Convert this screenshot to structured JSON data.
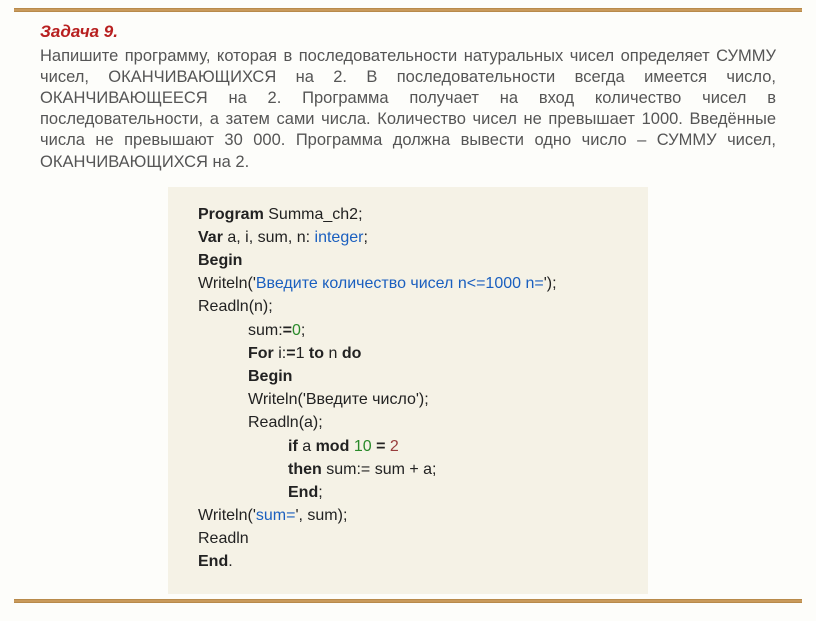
{
  "title": "Задача 9.",
  "description": "Напишите программу, которая в последовательности натуральных чисел определяет СУММУ чисел, ОКАНЧИВАЮЩИХСЯ на 2. В последовательности всегда имеется число, ОКАНЧИВАЮЩЕЕСЯ на 2. Программа получает на вход количество чисел в последовательности, а затем сами числа. Количество чисел не превышает 1000. Введённые числа не превышают 30 000. Программа должна вывести одно число – СУММУ чисел, ОКАНЧИВАЮЩИХСЯ на 2.",
  "code": {
    "l1_kw": "Program",
    "l1_rest": " Summa_ch2;",
    "l2_kw": "Var",
    "l2_rest_a": " a, i, sum, n: ",
    "l2_type": "integer",
    "l2_rest_b": ";",
    "l3": "Begin",
    "l4_a": "Writeln('",
    "l4_str": "Введите количество чисел n<=1000 n=",
    "l4_b": "');",
    "l5": "Readln(n);",
    "l6_a": "sum:",
    "l6_eq": "=",
    "l6_zero": "0",
    "l6_b": ";",
    "l7_for": "For",
    "l7_a": " i:",
    "l7_eq": "=",
    "l7_b": "1 ",
    "l7_to": "to",
    "l7_c": " n ",
    "l7_do": "do",
    "l8": "Begin",
    "l9": "Writeln('Введите число');",
    "l10": "Readln(a);",
    "l11_if": "if",
    "l11_a": " a ",
    "l11_mod": "mod",
    "l11_b": " ",
    "l11_ten": "10",
    "l11_c": " ",
    "l11_eq": "=",
    "l11_d": " ",
    "l11_two": "2",
    "l12_then": "then",
    "l12_a": " sum:= sum + a;",
    "l13_end": "End",
    "l13_b": ";",
    "l14_a": "Writeln('",
    "l14_str": "sum=",
    "l14_b": "', sum);",
    "l15": "Readln",
    "l16_end": "End",
    "l16_b": "."
  }
}
